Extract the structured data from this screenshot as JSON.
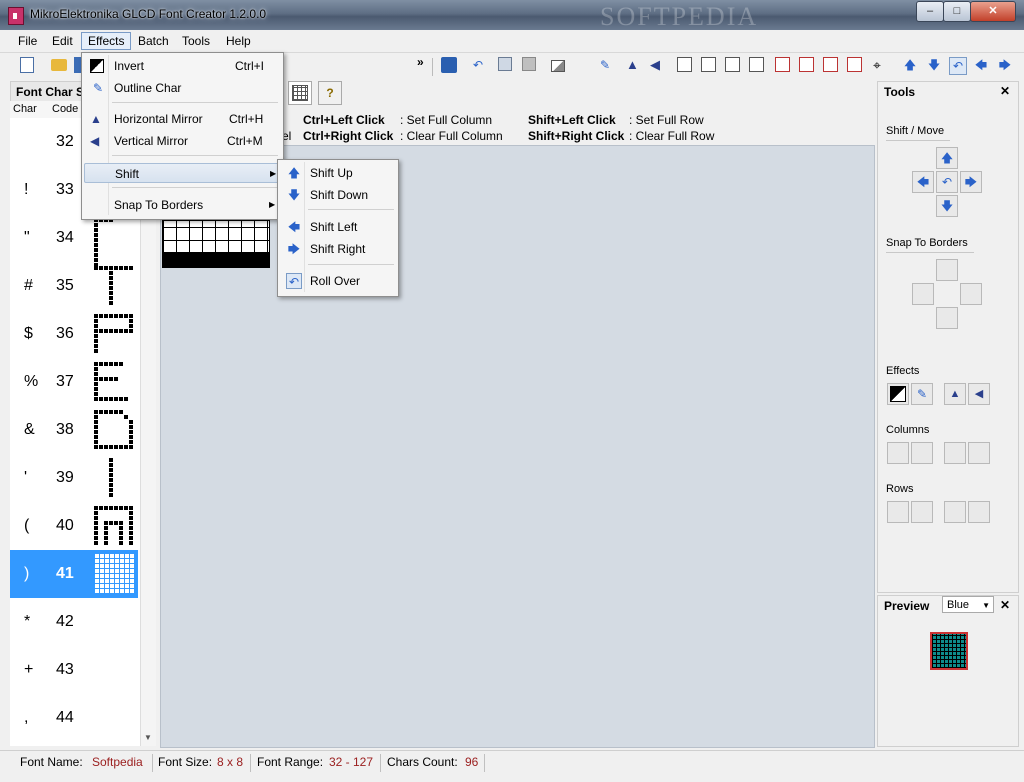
{
  "window": {
    "title": "MikroElektronika GLCD Font Creator 1.2.0.0",
    "watermark": "SOFTPEDIA"
  },
  "menubar": {
    "items": [
      "File",
      "Edit",
      "Effects",
      "Batch",
      "Tools",
      "Help"
    ],
    "open": "Effects"
  },
  "effects_menu": {
    "items": [
      {
        "label": "Invert",
        "shortcut": "Ctrl+I",
        "icon": "invert-icon"
      },
      {
        "label": "Outline Char",
        "shortcut": "",
        "icon": "outline-brush-icon"
      },
      {
        "label": "Horizontal Mirror",
        "shortcut": "Ctrl+H",
        "icon": "horizontal-mirror-icon"
      },
      {
        "label": "Vertical Mirror",
        "shortcut": "Ctrl+M",
        "icon": "vertical-mirror-icon"
      },
      {
        "label": "Shift",
        "shortcut": "",
        "icon": ""
      },
      {
        "label": "Snap To Borders",
        "shortcut": "",
        "icon": ""
      }
    ]
  },
  "shift_submenu": {
    "items": [
      {
        "label": "Shift Up",
        "icon": "arrow-up-icon"
      },
      {
        "label": "Shift Down",
        "icon": "arrow-down-icon"
      },
      {
        "label": "Shift Left",
        "icon": "arrow-left-icon"
      },
      {
        "label": "Shift Right",
        "icon": "arrow-right-icon"
      },
      {
        "label": "Roll Over",
        "icon": "roll-over-icon"
      }
    ]
  },
  "left_panel": {
    "title": "Font Char S",
    "col_char": "Char",
    "col_code": "Code",
    "rows": [
      {
        "char": "",
        "code": "32"
      },
      {
        "char": "!",
        "code": "33"
      },
      {
        "char": "\"",
        "code": "34"
      },
      {
        "char": "#",
        "code": "35"
      },
      {
        "char": "$",
        "code": "36"
      },
      {
        "char": "%",
        "code": "37"
      },
      {
        "char": "&",
        "code": "38"
      },
      {
        "char": "'",
        "code": "39"
      },
      {
        "char": "(",
        "code": "40"
      },
      {
        "char": ")",
        "code": "41"
      },
      {
        "char": "*",
        "code": "42"
      },
      {
        "char": "+",
        "code": "43"
      },
      {
        "char": ",",
        "code": "44"
      }
    ],
    "selected_code": "41"
  },
  "hints": {
    "row1_frag": "",
    "row2_frag": "el",
    "a1": "Ctrl+Left Click",
    "a1d": ": Set Full Column",
    "b1": "Shift+Left Click",
    "b1d": ": Set Full Row",
    "a2": "Ctrl+Right Click",
    "a2d": ": Clear Full Column",
    "b2": "Shift+Right Click",
    "b2d": ": Clear Full Row"
  },
  "tools": {
    "title": "Tools",
    "shift_move": "Shift / Move",
    "snap_to_borders": "Snap To Borders",
    "effects": "Effects",
    "columns": "Columns",
    "rows": "Rows"
  },
  "preview": {
    "title": "Preview",
    "color": "Blue"
  },
  "status": {
    "font_name_label": "Font Name:",
    "font_name": "Softpedia",
    "font_size_label": "Font Size:",
    "font_size": "8 x 8",
    "font_range_label": "Font Range:",
    "font_range": "32 - 127",
    "chars_count_label": "Chars Count:",
    "chars_count": "96"
  },
  "colors": {
    "selection": "#3399ff",
    "status_value": "#9b2020",
    "canvas": "#d4dbe3",
    "preview_fill": "#0e8b8b"
  }
}
